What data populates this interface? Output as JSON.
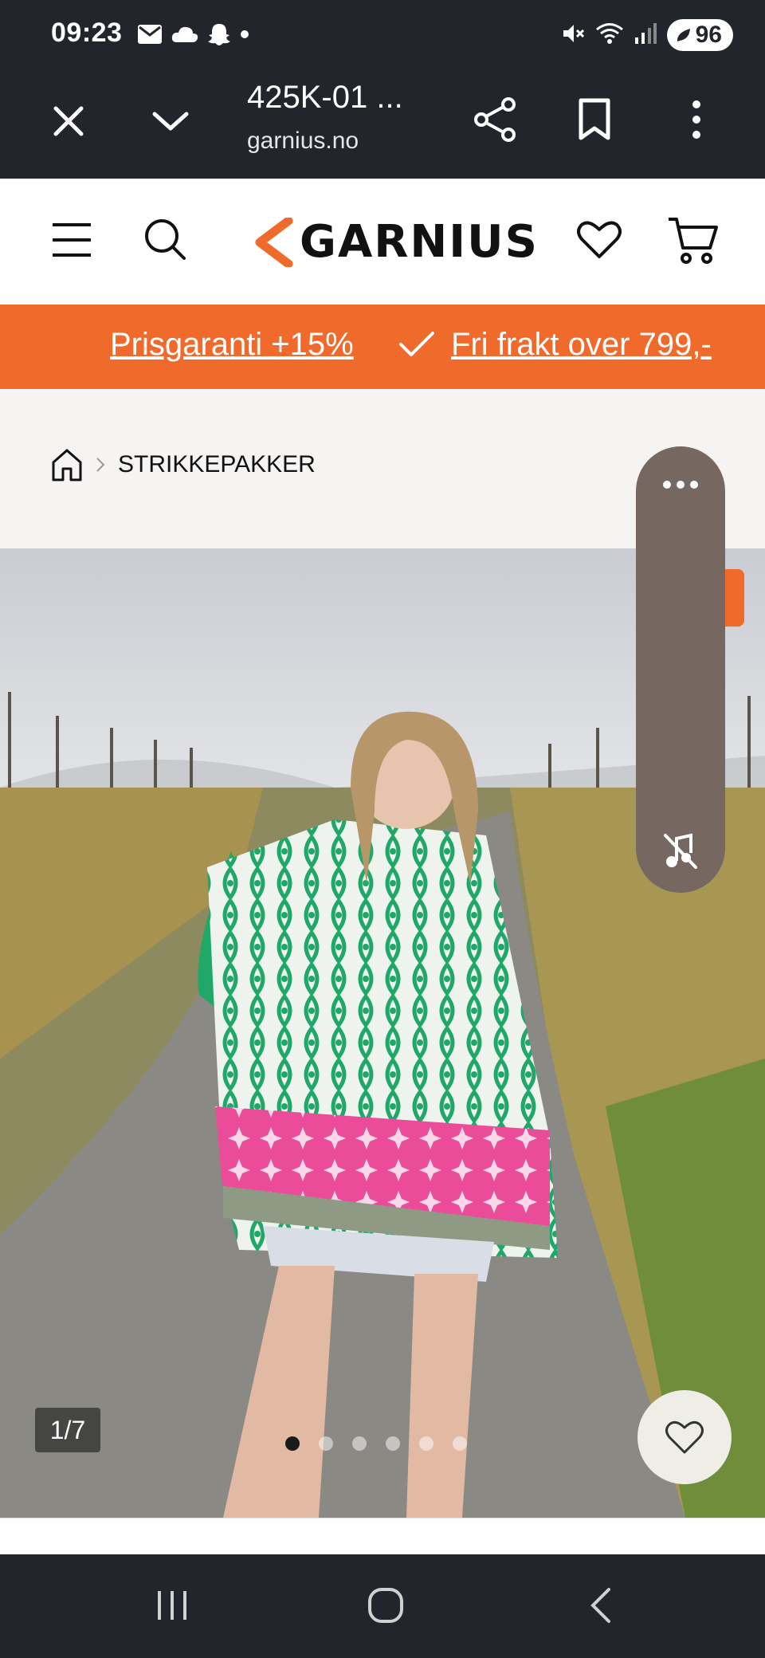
{
  "status_bar": {
    "time": "09:23",
    "battery": "96",
    "left_icons": [
      "mail-icon",
      "cloud-icon",
      "snapchat-icon",
      "dot-icon"
    ],
    "right_icons": [
      "mute-icon",
      "wifi-icon",
      "signal-icon",
      "battery-icon"
    ]
  },
  "browser": {
    "title": "425K-01 ...",
    "url": "garnius.no"
  },
  "site": {
    "logo_text": "GARNIUS",
    "brand_color": "#f06a2b"
  },
  "promo": {
    "item1": "Prisgaranti +15%",
    "item2": "Fri frakt over 799,-"
  },
  "breadcrumb": {
    "current": "STRIKKEPAKKER"
  },
  "gallery": {
    "counter": "1/7",
    "dots": [
      true,
      false,
      false,
      false,
      false,
      false
    ]
  }
}
